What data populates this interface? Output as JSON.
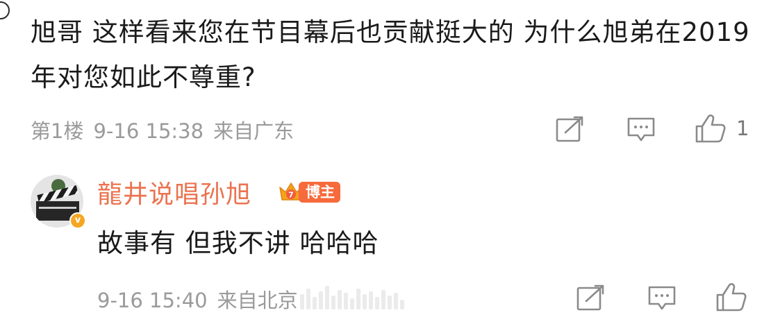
{
  "comment": {
    "text": "旭哥 这样看来您在节目幕后也贡献挺大的 为什么旭弟在2019年对您如此不尊重?",
    "floor": "第1楼",
    "time": "9-16 15:38",
    "location": "来自广东",
    "like_count": "1"
  },
  "reply": {
    "author": "龍井说唱孙旭",
    "crown_level": "7",
    "badge": "博主",
    "verified_mark": "v",
    "text": "故事有 但我不讲 哈哈哈",
    "time": "9-16 15:40",
    "location": "来自北京"
  },
  "colors": {
    "accent_name": "#eb7350",
    "badge_bg": "#f76a3c",
    "meta": "#9a9a9a",
    "icon": "#8a8a8a"
  },
  "icons": {
    "share": "share-icon",
    "comment": "comment-icon",
    "like": "thumbs-up-icon",
    "crown": "crown-icon",
    "verified": "verified-badge-icon"
  }
}
